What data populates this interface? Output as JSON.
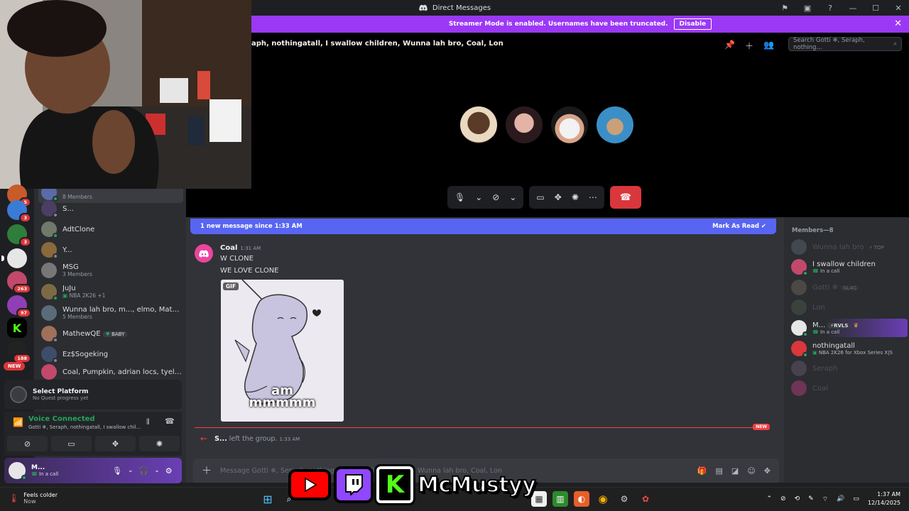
{
  "window": {
    "title": "Direct Messages"
  },
  "banner": {
    "text": "Streamer Mode is enabled. Usernames have been truncated.",
    "disable_label": "Disable"
  },
  "call": {
    "header": "aph, nothingatall, I swallow children, Wunna lah bro, Coal, Lon",
    "search_placeholder": "Search Gotti ❄, Seraph, nothing..."
  },
  "guild_badges": [
    "5",
    "3",
    "3",
    "263",
    "97",
    "188"
  ],
  "new_label": "NEW",
  "dms": [
    {
      "name": "8 Members",
      "sub": ""
    },
    {
      "name": "S...",
      "sub": ""
    },
    {
      "name": "AdtClone",
      "sub": ""
    },
    {
      "name": "Y...",
      "sub": ""
    },
    {
      "name": "MSG",
      "sub": "3 Members"
    },
    {
      "name": "JuJu",
      "sub": "NBA 2K26 +1"
    },
    {
      "name": "Wunna lah bro, m..., elmo, Mathe...",
      "sub": "5 Members"
    },
    {
      "name": "MathewQE",
      "sub": "",
      "tag": "BABY"
    },
    {
      "name": "Ez$Sogeking",
      "sub": ""
    },
    {
      "name": "Coal, Pumpkin, adrian locs, tyell,...",
      "sub": ""
    }
  ],
  "quest": {
    "title": "Select Platform",
    "sub": "No Quest progress yet"
  },
  "voice": {
    "status": "Voice Connected",
    "channel": "Gotti ❄, Seraph, nothingatall, I swallow chil..."
  },
  "user": {
    "name": "M...",
    "status": "In a call"
  },
  "chat": {
    "new_bar": "1 new message since 1:33 AM",
    "mark_read": "Mark As Read",
    "message": {
      "author": "Coal",
      "time": "1:31 AM",
      "line1": "W CLONE",
      "line2": "WE LOVE CLONE"
    },
    "gif": {
      "label": "GIF",
      "caption1": "am",
      "caption2": "mmmmm"
    },
    "new_divider": "NEW",
    "system": {
      "user": "S...",
      "text": "left the group.",
      "time": "1:33 AM"
    },
    "composer_placeholder": "Message Gotti ❄, Seraph, nothingatall, I swallow children, Wunna lah bro, Coal, Lon"
  },
  "members": {
    "header": "Members—8",
    "list": [
      {
        "name": "Wunna lah bro",
        "sub": "",
        "tag": "TOP",
        "offline": true
      },
      {
        "name": "I swallow children",
        "sub": "In a call",
        "offline": false
      },
      {
        "name": "Gotti ❄",
        "sub": "",
        "tag": "GL4G",
        "offline": true
      },
      {
        "name": "Lon",
        "sub": "",
        "offline": true
      },
      {
        "name": "M...",
        "sub": "In a call",
        "tag": "RVLS",
        "offline": false
      },
      {
        "name": "nothingatall",
        "sub": "NBA 2K26 for Xbox Series X|S",
        "offline": false
      },
      {
        "name": "Seraph",
        "sub": "",
        "offline": true
      },
      {
        "name": "Coal",
        "sub": "",
        "offline": true
      }
    ]
  },
  "taskbar": {
    "weather": "Feels colder",
    "weather_sub": "Now",
    "time": "1:37 AM",
    "date": "12/14/2025"
  },
  "overlay": {
    "handle": "McMustyy"
  },
  "colors": {
    "accent": "#5865f2",
    "streamer": "#9b38f5",
    "danger": "#da373c",
    "online": "#23a55a"
  }
}
